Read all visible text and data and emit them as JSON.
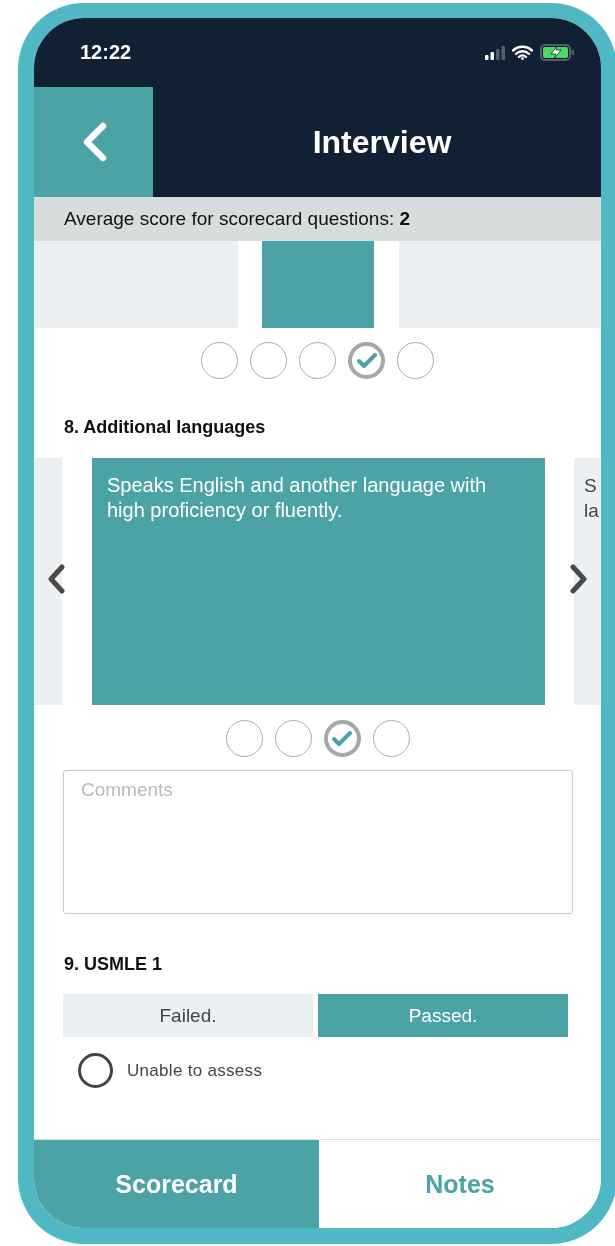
{
  "status_bar": {
    "time": "12:22"
  },
  "header": {
    "title": "Interview"
  },
  "average": {
    "text": "Average score for scorecard questions: **2**"
  },
  "previous_question": {
    "cards": [
      {
        "selected": false
      },
      {
        "selected": true
      },
      {
        "selected": false
      }
    ],
    "ratings": [
      {
        "selected": false
      },
      {
        "selected": false
      },
      {
        "selected": false
      },
      {
        "selected": true
      },
      {
        "selected": false
      }
    ]
  },
  "questions": [
    {
      "kind": "cards",
      "title": "8. Additional languages",
      "cards": [
        {
          "selected": false
        },
        {
          "text": "Speaks English and another language with high proficiency or fluently.",
          "selected": true
        },
        {
          "text": "S\nla",
          "selected": false
        }
      ],
      "ratings": [
        {
          "selected": false
        },
        {
          "selected": false
        },
        {
          "selected": true
        },
        {
          "selected": false
        }
      ],
      "comments": {
        "placeholder": "Comments"
      }
    },
    {
      "kind": "choice",
      "title": "9. USMLE 1",
      "options": [
        {
          "label": "Failed.",
          "selected": false
        },
        {
          "label": "Passed.",
          "selected": true
        }
      ],
      "unable": {
        "label": "Unable to assess",
        "checked": false
      }
    }
  ],
  "tabs": [
    {
      "label": "Scorecard",
      "selected": true
    },
    {
      "label": "Notes",
      "selected": false
    }
  ]
}
